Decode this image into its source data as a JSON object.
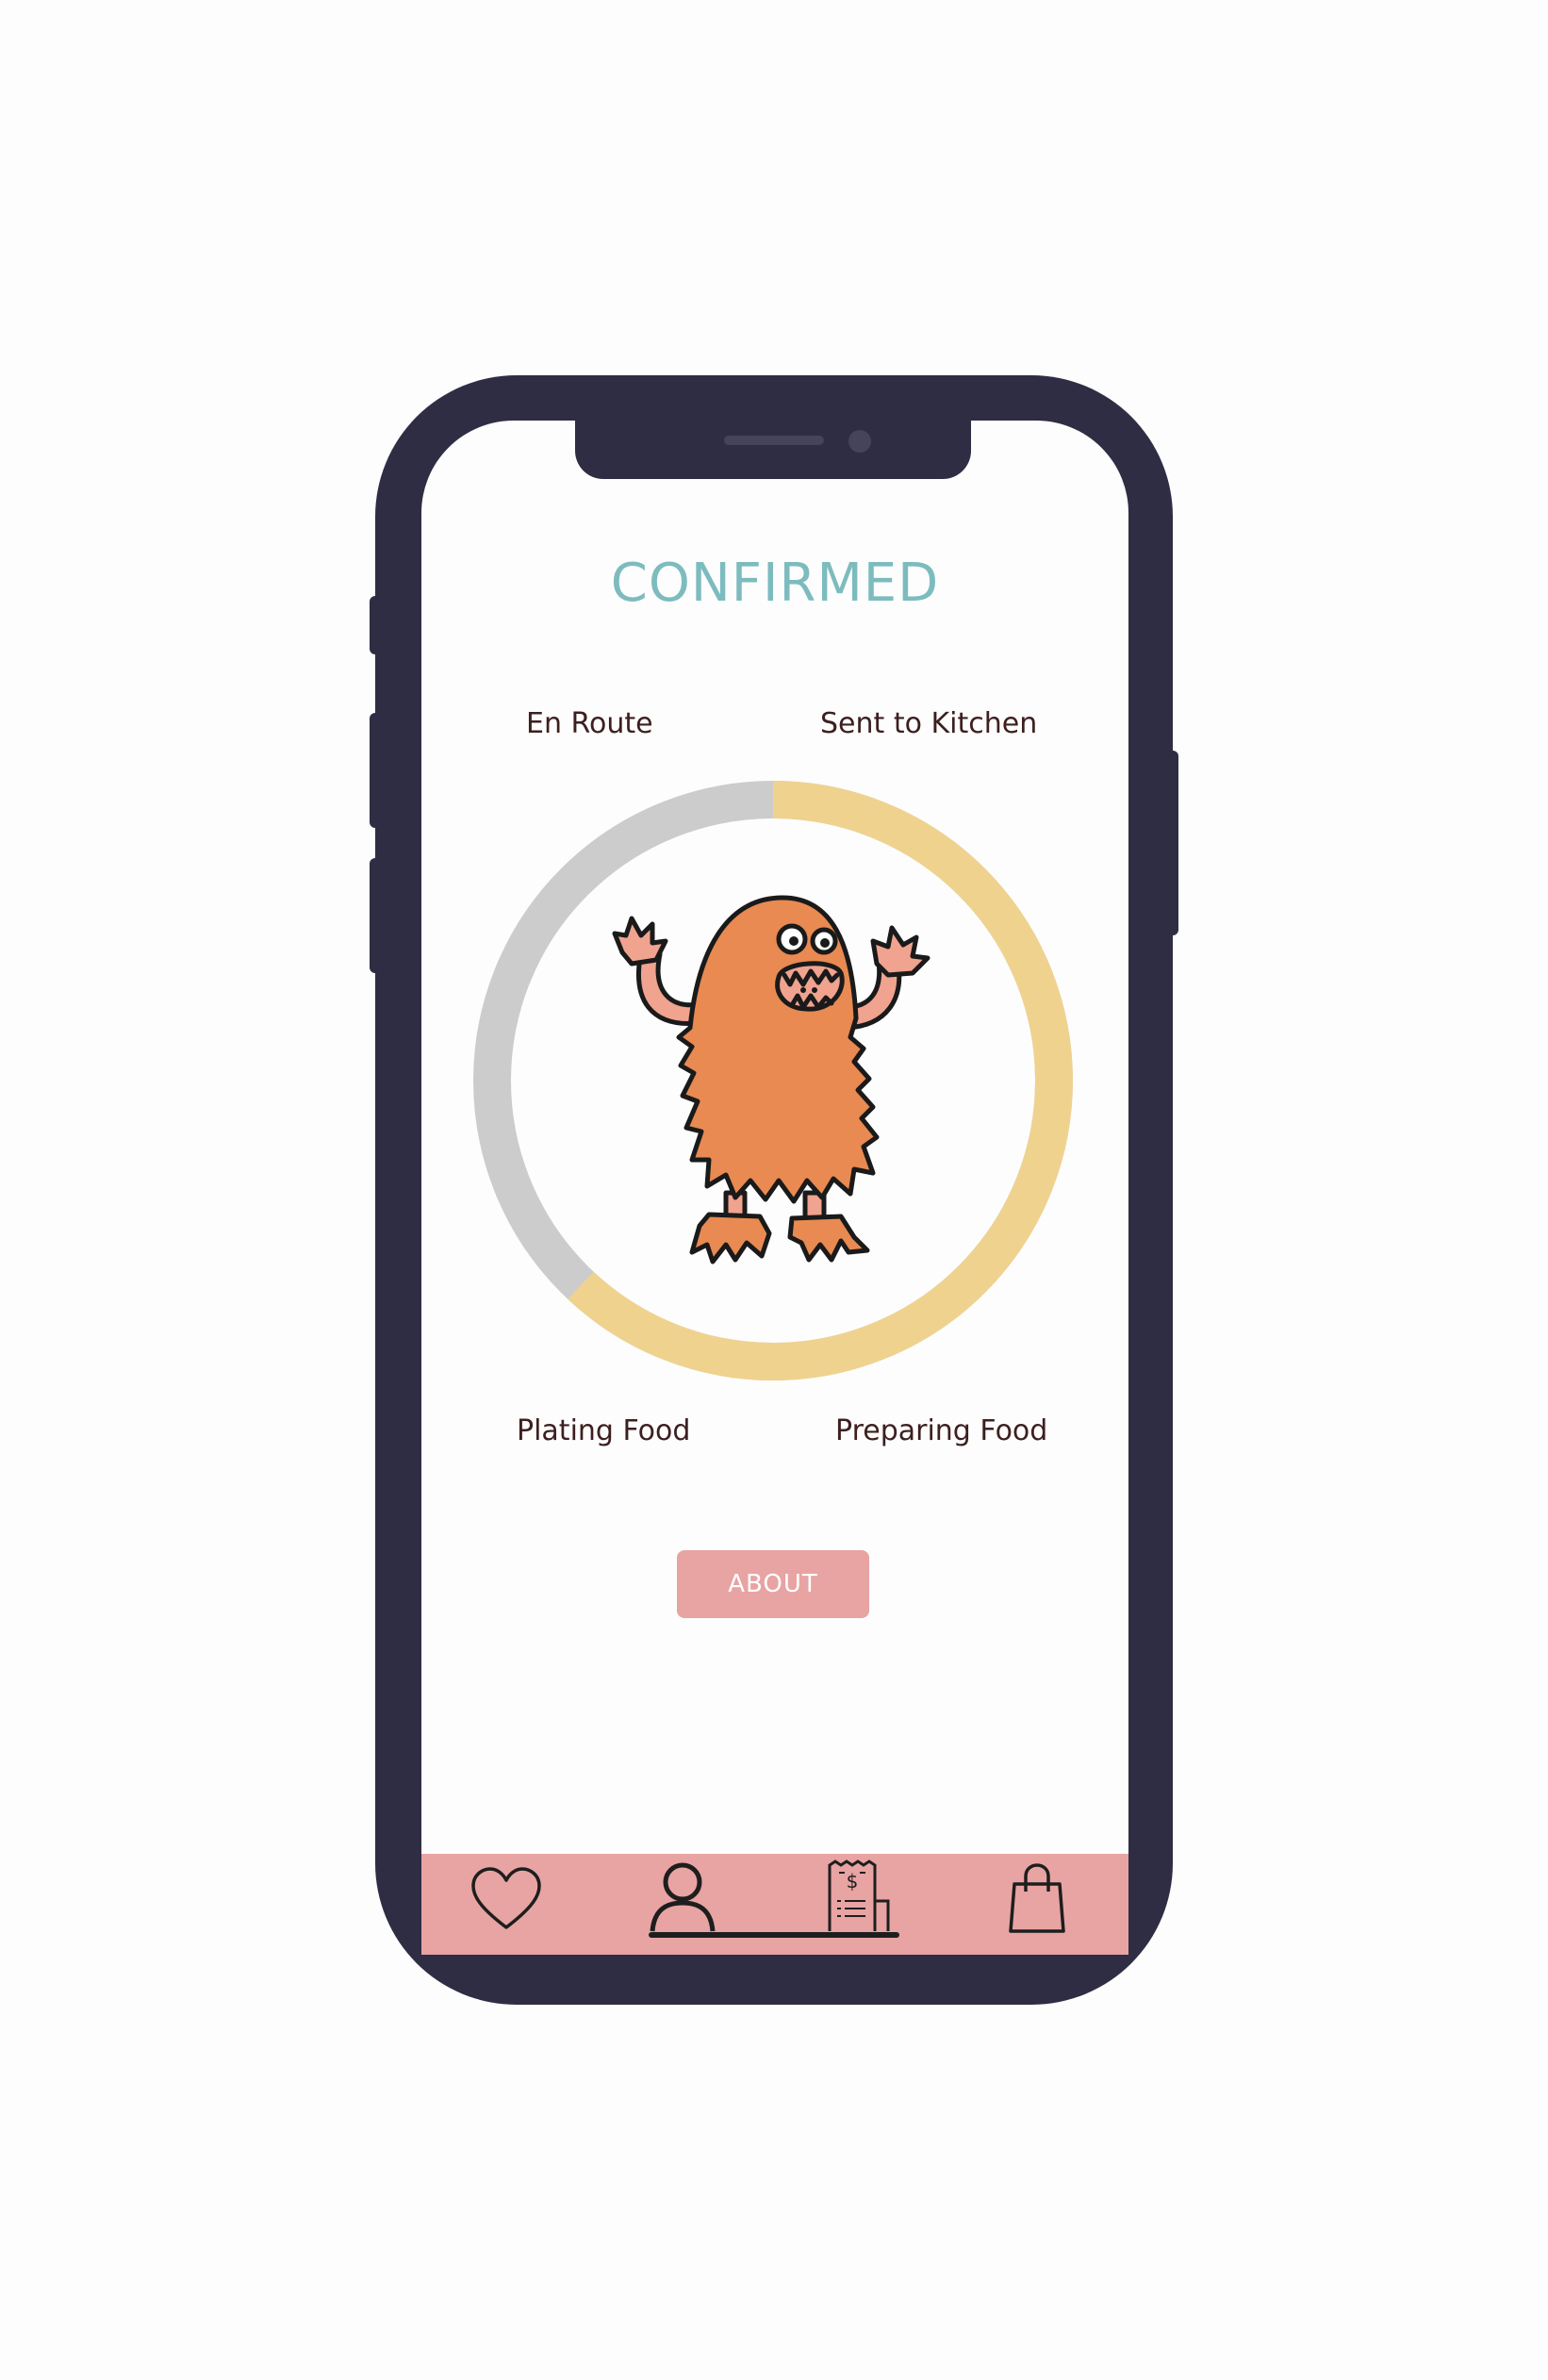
{
  "screen": {
    "title": "CONFIRMED",
    "progress": 0.62,
    "steps": {
      "top_left": "En Route",
      "top_right": "Sent to Kitchen",
      "bottom_left": "Plating Food",
      "bottom_right": "Preparing Food"
    },
    "about_button": "ABOUT"
  },
  "nav": {
    "items": [
      "heart-icon",
      "profile-icon",
      "receipt-icon",
      "shopping-bag-icon"
    ],
    "active": "profile-icon"
  },
  "colors": {
    "frame": "#2e2d43",
    "title": "#7dbcbe",
    "ring_track": "#cccccc",
    "ring_progress": "#f0d28f",
    "accent_pink": "#e8a3a3",
    "monster": "#e88a52"
  }
}
